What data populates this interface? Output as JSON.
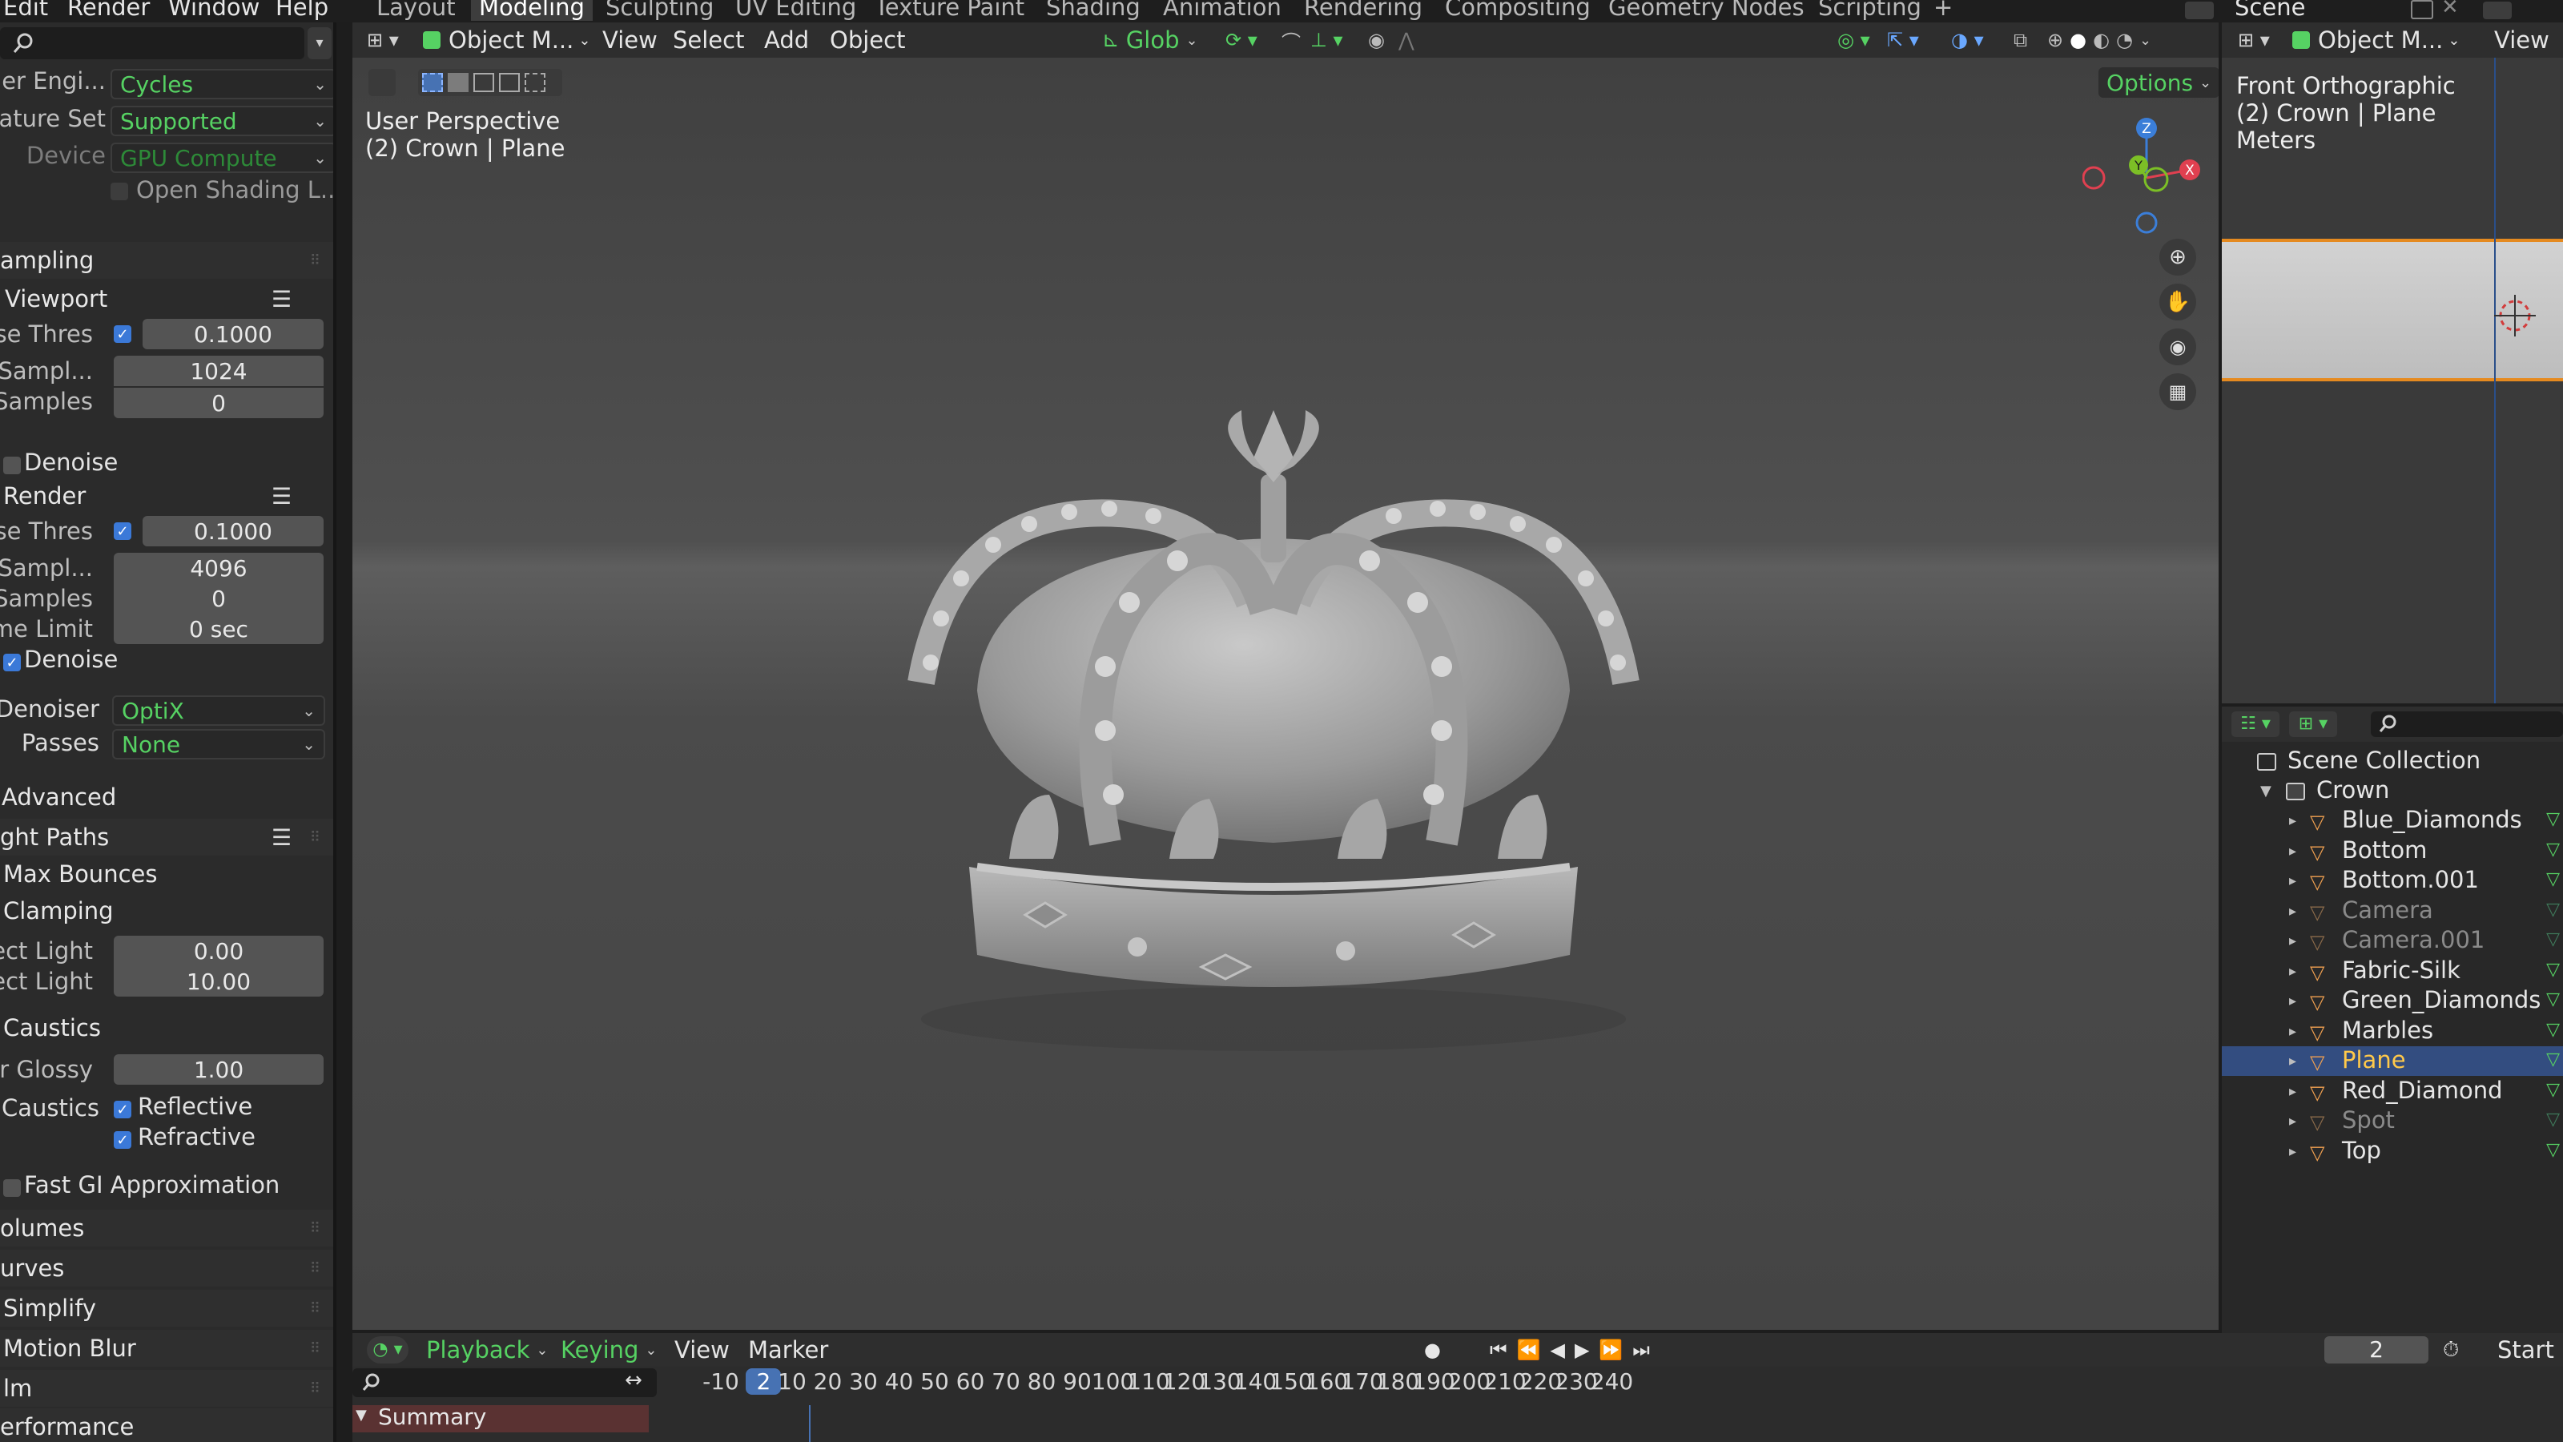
{
  "topbar": {
    "menus": [
      "Edit",
      "Render",
      "Window",
      "Help"
    ],
    "workspaces": [
      "Layout",
      "Modeling",
      "Sculpting",
      "UV Editing",
      "Texture Paint",
      "Shading",
      "Animation",
      "Rendering",
      "Compositing",
      "Geometry Nodes",
      "Scripting"
    ],
    "active_workspace": "Modeling",
    "add_workspace": "+",
    "scene_name": "Scene"
  },
  "properties": {
    "render_engine_label": "der Engi...",
    "render_engine_value": "Cycles",
    "feature_set_label": "ature Set",
    "feature_set_value": "Supported",
    "device_label": "Device",
    "device_value": "GPU Compute",
    "open_shading": "Open Shading L...",
    "sampling_header": "ampling",
    "viewport_header": "Viewport",
    "vp_noise_label": "se Thres",
    "vp_noise_value": "0.1000",
    "vp_max_label": "x Sampl...",
    "vp_max_value": "1024",
    "vp_min_label": "Samples",
    "vp_min_value": "0",
    "vp_denoise": "Denoise",
    "render_header": "Render",
    "r_noise_label": "se Thres",
    "r_noise_value": "0.1000",
    "r_max_label": "x Sampl...",
    "r_max_value": "4096",
    "r_min_label": "Samples",
    "r_min_value": "0",
    "r_time_label": "ime Limit",
    "r_time_value": "0 sec",
    "r_denoise": "Denoise",
    "denoiser_label": "Denoiser",
    "denoiser_value": "OptiX",
    "passes_label": "Passes",
    "passes_value": "None",
    "advanced_header": "Advanced",
    "light_paths_header": "ght Paths",
    "max_bounces_header": "Max Bounces",
    "clamping_header": "Clamping",
    "direct_label": "rect Light",
    "direct_value": "0.00",
    "indirect_label": "rect Light",
    "indirect_value": "10.00",
    "caustics_header": "Caustics",
    "filter_glossy_label": "er Glossy",
    "filter_glossy_value": "1.00",
    "caustics_label": "Caustics",
    "reflective": "Reflective",
    "refractive": "Refractive",
    "fast_gi": "Fast GI Approximation",
    "volumes_header": "olumes",
    "curves_header": "urves",
    "simplify_header": "Simplify",
    "motion_blur_header": "Motion Blur",
    "film_header": "lm",
    "performance_header": "erformance"
  },
  "viewport": {
    "mode": "Object M...",
    "menus": [
      "View",
      "Select",
      "Add",
      "Object"
    ],
    "transform": "Glob",
    "options": "Options",
    "perspective": "User Perspective",
    "object_info": "(2) Crown | Plane",
    "gizmo_x": "X",
    "gizmo_y": "Y",
    "gizmo_z": "Z"
  },
  "side_view": {
    "mode": "Object M...",
    "view_menu": "View",
    "title": "Front Orthographic",
    "object_info": "(2) Crown | Plane",
    "units": "Meters"
  },
  "outliner": {
    "root": "Scene Collection",
    "collection": "Crown",
    "items": [
      {
        "name": "Blue_Diamonds",
        "dim": false,
        "selected": false
      },
      {
        "name": "Bottom",
        "dim": false,
        "selected": false
      },
      {
        "name": "Bottom.001",
        "dim": false,
        "selected": false
      },
      {
        "name": "Camera",
        "dim": true,
        "selected": false
      },
      {
        "name": "Camera.001",
        "dim": true,
        "selected": false
      },
      {
        "name": "Fabric-Silk",
        "dim": false,
        "selected": false
      },
      {
        "name": "Green_Diamonds",
        "dim": false,
        "selected": false
      },
      {
        "name": "Marbles",
        "dim": false,
        "selected": false
      },
      {
        "name": "Plane",
        "dim": false,
        "selected": true
      },
      {
        "name": "Red_Diamond",
        "dim": false,
        "selected": false
      },
      {
        "name": "Spot",
        "dim": true,
        "selected": false
      },
      {
        "name": "Top",
        "dim": false,
        "selected": false
      }
    ]
  },
  "timeline": {
    "playback": "Playback",
    "keying": "Keying",
    "view": "View",
    "marker": "Marker",
    "current_frame": "2",
    "start_label": "Start",
    "summary": "Summary",
    "ticks": [
      "-10",
      "2",
      "10",
      "20",
      "30",
      "40",
      "50",
      "60",
      "70",
      "80",
      "90",
      "100",
      "110",
      "120",
      "130",
      "140",
      "150",
      "160",
      "170",
      "180",
      "190",
      "200",
      "210",
      "220",
      "230",
      "240"
    ]
  },
  "colors": {
    "accent_green": "#56d263",
    "selection_blue": "#334d80",
    "active_orange": "#ffc94a",
    "checkbox_blue": "#3b79d8"
  }
}
